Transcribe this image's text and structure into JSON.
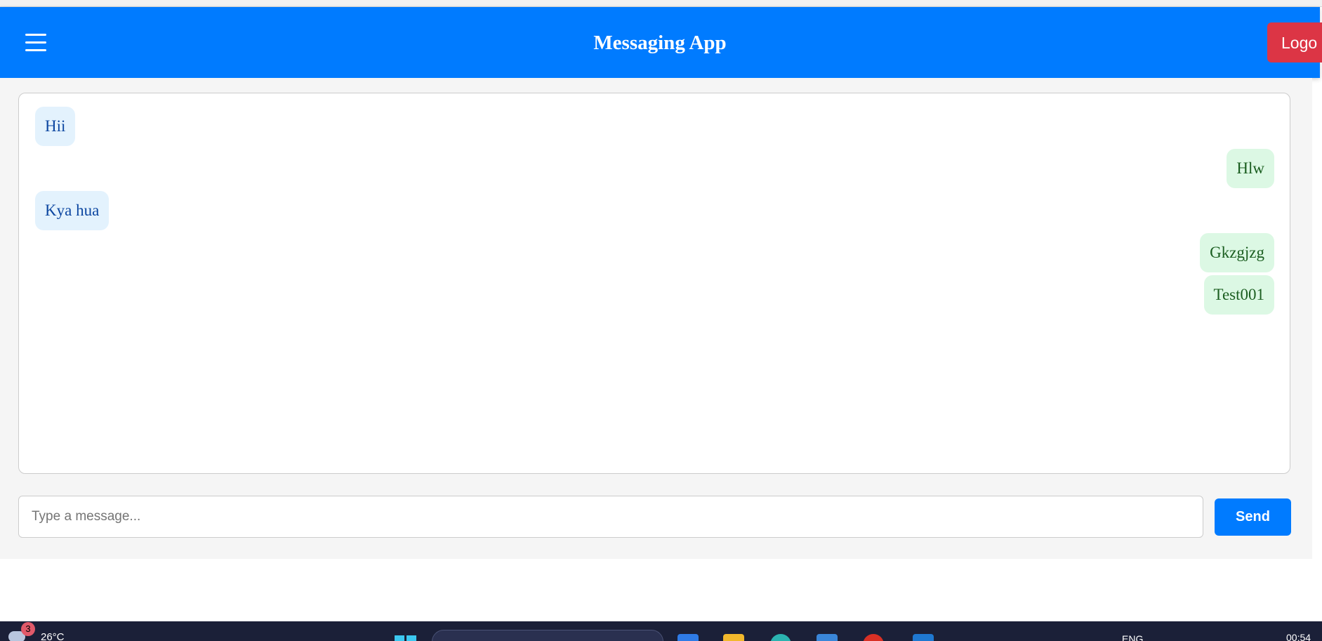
{
  "header": {
    "title": "Messaging App",
    "logout_label": "Logo"
  },
  "messages": [
    {
      "text": "Hii",
      "side": "received"
    },
    {
      "text": "Hlw",
      "side": "sent"
    },
    {
      "text": "Kya hua",
      "side": "received"
    },
    {
      "text": "Gkzgjzg",
      "side": "sent"
    },
    {
      "text": "Test001",
      "side": "sent"
    }
  ],
  "composer": {
    "placeholder": "Type a message...",
    "value": "",
    "send_label": "Send"
  },
  "taskbar": {
    "weather_badge": "3",
    "temperature": "26°C",
    "language": "ENG",
    "clock": "00:54"
  },
  "colors": {
    "header": "#007bff",
    "logout": "#dc3545",
    "send": "#007bff",
    "received_bubble": "#e3f2fd",
    "sent_bubble": "#dcf8e4"
  }
}
